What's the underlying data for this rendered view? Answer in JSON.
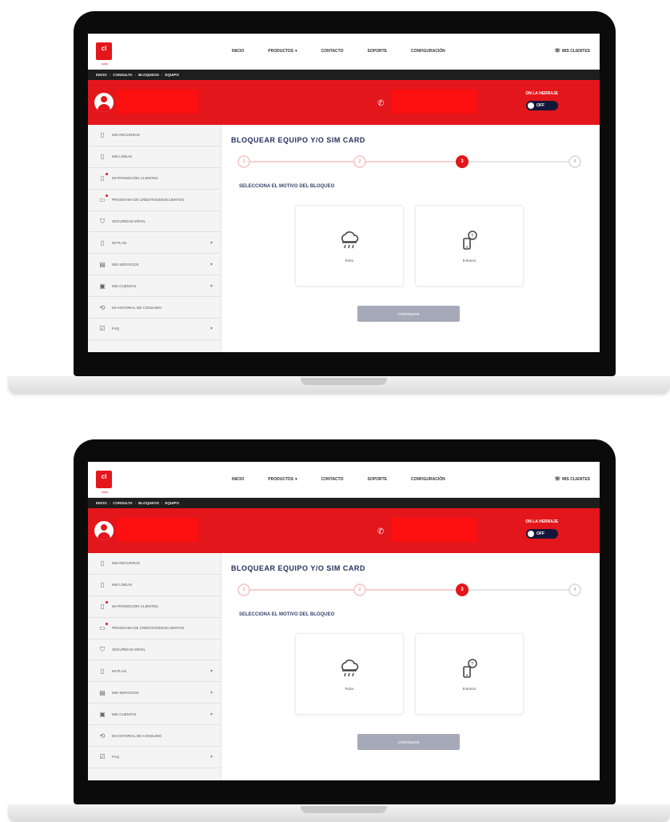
{
  "app": {
    "logo": "cl",
    "logo_sub": "claro"
  },
  "nav": {
    "items": [
      "INICIO",
      "PRODUCTOS",
      "CONTACTO",
      "SOPORTE",
      "CONFIGURACIÓN"
    ],
    "caret": "▾",
    "help": "MIS CLIENTES",
    "help_icon": "☏"
  },
  "breadcrumb": [
    "INICIO",
    "CONSULTA",
    "BLOQUEOS",
    "EQUIPO"
  ],
  "header": {
    "toggle_label": "ON LA HERRAJE",
    "toggle_value": "OFF",
    "accent_color": "#e3161b",
    "redaction_color": "#ff1010"
  },
  "sidebar": {
    "items": [
      {
        "icon": "phone-icon",
        "glyph": "▯",
        "label": "MIS RECURSOS",
        "chevron": false,
        "alert": false
      },
      {
        "icon": "phone-icon",
        "glyph": "▯",
        "label": "MIS LÍNEAS",
        "chevron": false,
        "alert": false
      },
      {
        "icon": "alert-phone-icon",
        "glyph": "▯",
        "label": "MI PROMOCIÓN CLIENTES",
        "chevron": false,
        "alert": true
      },
      {
        "icon": "card-alert-icon",
        "glyph": "▭",
        "label": "PROGRAMA DE CRÉDITOS/DESCUENTOS",
        "chevron": false,
        "alert": true
      },
      {
        "icon": "shield-icon",
        "glyph": "⛉",
        "label": "SEGURIDAD MÓVIL",
        "chevron": false,
        "alert": false
      },
      {
        "icon": "document-icon",
        "glyph": "▯",
        "label": "MI PLAN",
        "chevron": true,
        "alert": false
      },
      {
        "icon": "box-icon",
        "glyph": "▤",
        "label": "MIS SERVICIOS",
        "chevron": true,
        "alert": false
      },
      {
        "icon": "receipt-icon",
        "glyph": "▣",
        "label": "MIS CUENTAS",
        "chevron": true,
        "alert": false
      },
      {
        "icon": "history-icon",
        "glyph": "⟲",
        "label": "MI HISTORIAL DE CONSUMO",
        "chevron": false,
        "alert": false
      },
      {
        "icon": "checklist-icon",
        "glyph": "☑",
        "label": "FAQ",
        "chevron": true,
        "alert": false
      }
    ]
  },
  "main": {
    "title": "BLOQUEAR EQUIPO Y/O SIM CARD",
    "steps": [
      {
        "label": "1",
        "state": "done"
      },
      {
        "label": "2",
        "state": "done"
      },
      {
        "label": "3",
        "state": "active"
      },
      {
        "label": "4",
        "state": "todo"
      }
    ],
    "subtitle": "SELECCIONA EL MOTIVO DEL BLOQUEO",
    "options": [
      {
        "label": "Robo",
        "icon": "cloud-rain-icon"
      },
      {
        "label": "Extravío",
        "icon": "lost-icon"
      }
    ],
    "continue_label": "CONTINUAR"
  }
}
